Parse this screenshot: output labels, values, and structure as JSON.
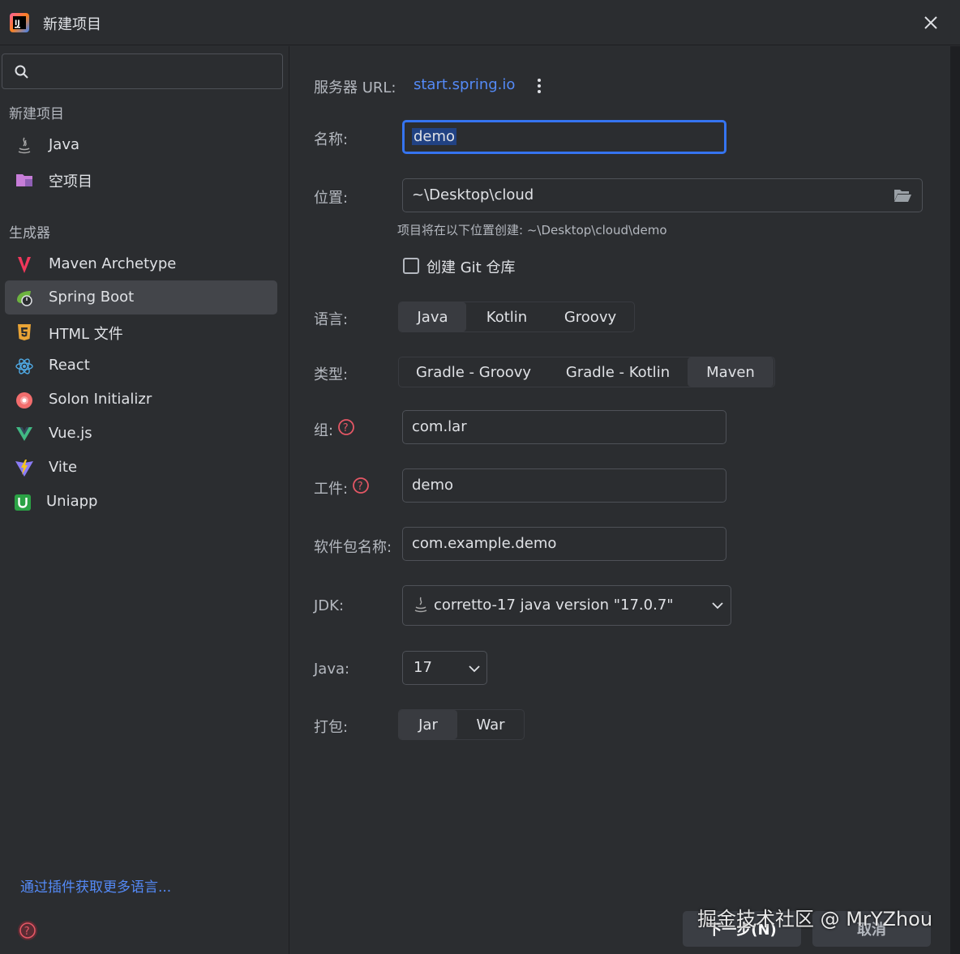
{
  "window": {
    "title": "新建项目",
    "close_icon": "close-icon"
  },
  "sidebar": {
    "search_placeholder": "",
    "section_new_project": "新建项目",
    "section_generators": "生成器",
    "items": [
      {
        "label": "Java",
        "icon": "java-icon"
      },
      {
        "label": "空项目",
        "icon": "folder-icon"
      },
      {
        "label": "Maven Archetype",
        "icon": "maven-icon"
      },
      {
        "label": "Spring Boot",
        "icon": "spring-boot-icon",
        "selected": true
      },
      {
        "label": "HTML 文件",
        "icon": "html5-icon"
      },
      {
        "label": "React",
        "icon": "react-icon"
      },
      {
        "label": "Solon Initializr",
        "icon": "solon-icon"
      },
      {
        "label": "Vue.js",
        "icon": "vue-icon"
      },
      {
        "label": "Vite",
        "icon": "vite-icon"
      },
      {
        "label": "Uniapp",
        "icon": "uniapp-icon"
      }
    ],
    "plugin_link": "通过插件获取更多语言..."
  },
  "form": {
    "server_url_label": "服务器 URL:",
    "server_url_value": "start.spring.io",
    "name_label": "名称:",
    "name_value": "demo",
    "location_label": "位置:",
    "location_value": "~\\Desktop\\cloud",
    "location_hint": "项目将在以下位置创建: ~\\Desktop\\cloud\\demo",
    "git_checkbox_label": "创建 Git 仓库",
    "git_checked": false,
    "language_label": "语言:",
    "language_options": [
      "Java",
      "Kotlin",
      "Groovy"
    ],
    "language_selected": "Java",
    "type_label": "类型:",
    "type_options": [
      "Gradle - Groovy",
      "Gradle - Kotlin",
      "Maven"
    ],
    "type_selected": "Maven",
    "group_label": "组:",
    "group_value": "com.lar",
    "artifact_label": "工件:",
    "artifact_value": "demo",
    "package_label": "软件包名称:",
    "package_value": "com.example.demo",
    "jdk_label": "JDK:",
    "jdk_value": "corretto-17 java version \"17.0.7\"",
    "java_label": "Java:",
    "java_value": "17",
    "packaging_label": "打包:",
    "packaging_options": [
      "Jar",
      "War"
    ],
    "packaging_selected": "Jar"
  },
  "footer": {
    "next_button": "下一步(N)",
    "cancel_button": "取消"
  },
  "watermark": "掘金技术社区 @ MrYZhou",
  "colors": {
    "accent": "#3574f0",
    "link": "#548af7",
    "help": "#e55765",
    "background": "#2b2d30"
  }
}
